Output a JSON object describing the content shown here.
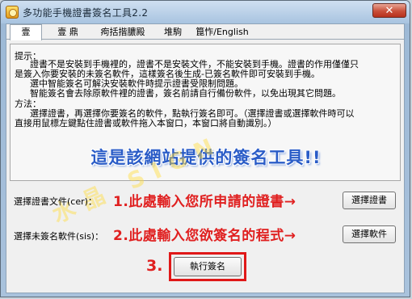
{
  "window": {
    "title": "多功能手機證書簽名工具2.2",
    "close_label": "✕"
  },
  "tabs": [
    {
      "label": "壹"
    },
    {
      "label": "壹 鼎"
    },
    {
      "label": "痀括揩膿殿"
    },
    {
      "label": "堆駒"
    },
    {
      "label": "箟怍/English"
    }
  ],
  "hint": {
    "title": "提示：",
    "lines": [
      "證書不是安裝到手機裡的，證書不是安裝文件，不能安裝到手機。證書的作用僅僅只",
      "是簽入你要安裝的未簽名軟件，這樣簽名後生成-已簽名軟件即可安裝到手機。",
      "選中智能簽名可解決安裝軟件時提示證書受限制問題。",
      "智能簽名會去除原軟件裡的證書，簽名前請自行備份軟件，以免出現其它問題。",
      "方法：",
      "選擇證書，再選擇你要簽名的軟件，點執行簽名即可。（選擇證書或選擇軟件時可以",
      "直接用鼠標左鍵點住證書或軟件拖入本窗口，本窗口將自動識別。）"
    ],
    "banner": "這是該網站提供的簽名工具!!",
    "watermark": "水晶 SIGN"
  },
  "cert_row": {
    "label": "選擇證書文件(cer)：",
    "note": "1.此處輸入您所申請的證書→",
    "button": "選擇證書"
  },
  "sis_row": {
    "label": "選擇未簽名軟件(sis)：",
    "note": "2.此處輸入您欲簽名的程式→",
    "button": "選擇軟件"
  },
  "exec": {
    "step": "3.",
    "button": "執行簽名"
  }
}
